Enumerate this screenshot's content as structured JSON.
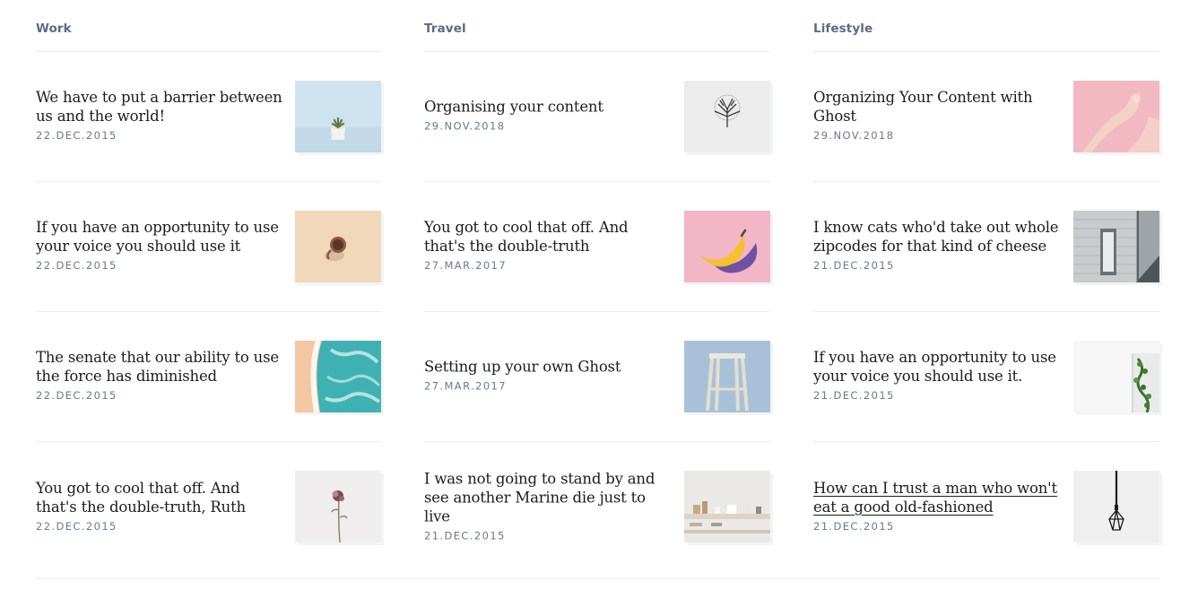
{
  "columns": [
    {
      "title": "Work",
      "posts": [
        {
          "title": "We have to put a barrier between us and the world!",
          "date": "22.DEC.2015",
          "image": "succulent-pot-image"
        },
        {
          "title": "If you have an opportunity to use your voice you should use it",
          "date": "22.DEC.2015",
          "image": "coffee-cup-image"
        },
        {
          "title": "The senate that our ability to use the force has diminished",
          "date": "22.DEC.2015",
          "image": "ocean-waves-image"
        },
        {
          "title": "You got to cool that off. And that's the double-truth, Ruth",
          "date": "22.DEC.2015",
          "image": "dried-flower-image"
        }
      ]
    },
    {
      "title": "Travel",
      "posts": [
        {
          "title": "Organising your content",
          "date": "29.NOV.2018",
          "image": "bare-tree-image"
        },
        {
          "title": "You got to cool that off. And that's the double-truth",
          "date": "27.MAR.2017",
          "image": "banana-image"
        },
        {
          "title": "Setting up your own Ghost",
          "date": "27.MAR.2017",
          "image": "wooden-stool-image"
        },
        {
          "title": "I was not going to stand by and see another Marine die just to live",
          "date": "21.DEC.2015",
          "image": "kitchen-shelf-image"
        }
      ]
    },
    {
      "title": "Lifestyle",
      "posts": [
        {
          "title": "Organizing Your Content with Ghost",
          "date": "29.NOV.2018",
          "image": "hands-pink-image"
        },
        {
          "title": "I know cats who'd take out whole zipcodes for that kind of cheese",
          "date": "21.DEC.2015",
          "image": "building-door-image"
        },
        {
          "title": "If you have an opportunity to use your voice you should use it.",
          "date": "21.DEC.2015",
          "image": "ivy-window-image"
        },
        {
          "title": "How can I trust a man who won't eat a good old-fashioned",
          "date": "21.DEC.2015",
          "image": "pendant-lamp-image"
        }
      ]
    }
  ]
}
